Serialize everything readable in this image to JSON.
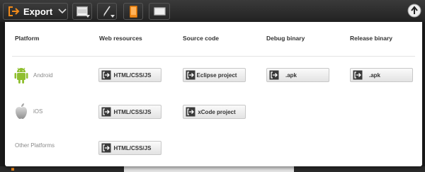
{
  "toolbar": {
    "export_label": "Export"
  },
  "export_panel": {
    "columns": [
      "Platform",
      "Web resources",
      "Source code",
      "Debug binary",
      "Release binary"
    ],
    "rows": [
      {
        "platform": "Android",
        "web": "HTML/CSS/JS",
        "source": "Eclipse project",
        "debug": ".apk",
        "release": ".apk"
      },
      {
        "platform": "iOS",
        "web": "HTML/CSS/JS",
        "source": "xCode project"
      },
      {
        "platform": "Other Platforms",
        "web": "HTML/CSS/JS"
      }
    ]
  },
  "colors": {
    "accent_orange": "#f08a1a",
    "android_green": "#8fbf2f"
  },
  "icons": [
    "export-icon",
    "chevron-down-icon",
    "panel-icon",
    "pen-icon",
    "phone-icon",
    "tablet-icon",
    "upload-icon",
    "android-icon",
    "apple-icon",
    "export-arrow-icon"
  ]
}
